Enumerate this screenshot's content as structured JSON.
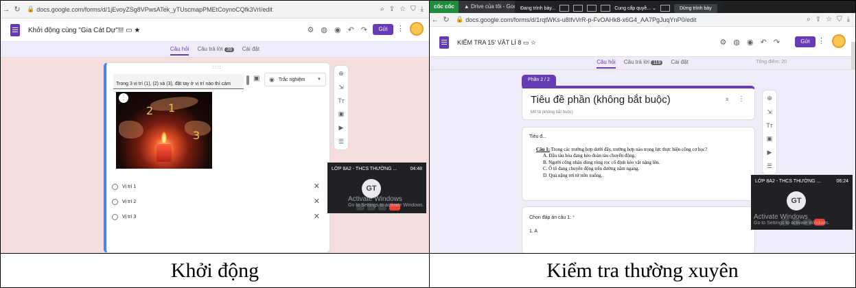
{
  "captions": {
    "left": "Khởi động",
    "right": "Kiểm tra thường xuyên"
  },
  "left": {
    "url": "docs.google.com/forms/d/1jEvoyZSg8VPwsATek_yTUscmapPMEtCoynoCQfk3VrI/edit",
    "form_title": "Khởi động cùng \"Gia Cát Dự\"!!!",
    "tabs": {
      "questions": "Câu hỏi",
      "responses": "Câu trả lời",
      "responses_count": "39",
      "settings": "Cài đặt"
    },
    "send_label": "Gửi",
    "question_text": "Trong 3 vị trí (1), (2) và (3), đặt tay ở vị trí nào thì cảm thấy ít nóng nhất?",
    "question_type": "Trắc nghiệm",
    "image_numbers": [
      "2",
      "1",
      "3"
    ],
    "options": [
      "Vị trí 1",
      "Vị trí 2",
      "Vị trí 3"
    ],
    "meet": {
      "title": "LỚP 8A2 - THCS THƯỜNG ...",
      "time": "04:48",
      "initials": "GT"
    },
    "watermark": {
      "line1": "Activate Windows",
      "line2": "Go to Settings to activate Windows."
    }
  },
  "right": {
    "browser_label": "cốc cốc",
    "drive_tab": "Drive của tôi - Google",
    "url": "docs.google.com/forms/d/1rqtWKs-u8IfvVrR-p-FvOAHk8-x6G4_AA7PgJuqYnP0/edit",
    "presenting": {
      "label": "Đang trình bày...",
      "offer": "Cung cấp quyề...",
      "stop": "Dừng trình bày"
    },
    "form_title": "KIỂM TRA 15' VẬT LÍ 8",
    "tabs": {
      "questions": "Câu hỏi",
      "responses": "Câu trả lời",
      "responses_count": "119",
      "settings": "Cài đặt"
    },
    "total_score": "Tổng điểm: 20",
    "send_label": "Gửi",
    "section_badge": "Phần 2 / 2",
    "section_title": "Tiêu đề phần (không bắt buộc)",
    "section_desc": "Mô tả (không bắt buộc)",
    "block_title": "Tiêu đ...",
    "question_label": "Câu 1:",
    "question_text": "Trong các trường hợp dưới đây, trường hợp nào trọng lực thực hiện công cơ học?",
    "choices": [
      "A. Đầu tàu hỏa đang kéo đoàn tàu chuyển động.",
      "B. Người công nhân dùng ròng rọc cố định kéo vật nặng lên.",
      "C. Ô tô đang chuyển động trên đường nằm ngang.",
      "D. Quả nặng rơi từ trên xuống."
    ],
    "answer_prompt": "Chọn đáp án câu 1:",
    "required_mark": "*",
    "answer_option": "1. A",
    "meet": {
      "title": "LỚP 8A2 - THCS THƯỜNG ...",
      "time": "06:24",
      "initials": "GT"
    },
    "watermark": {
      "line1": "Activate Windows",
      "line2": "Go to Settings to activate Windows."
    }
  }
}
